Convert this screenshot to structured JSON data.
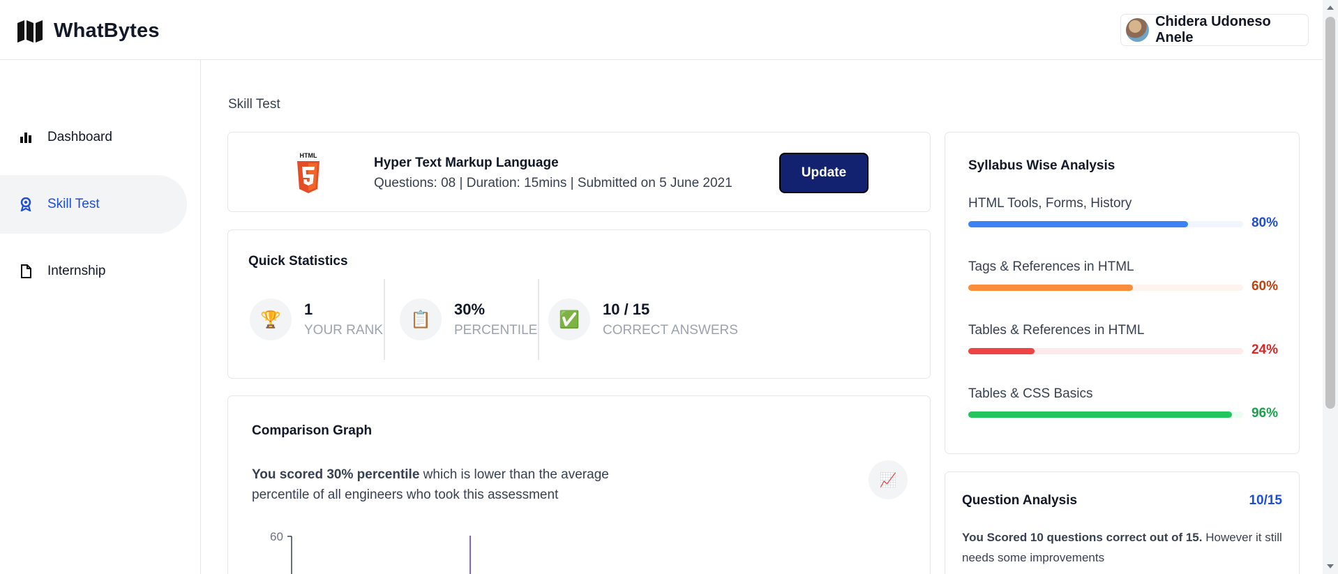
{
  "header": {
    "brand": "WhatBytes",
    "user_name": "Chidera Udoneso Anele"
  },
  "sidebar": {
    "items": [
      {
        "label": "Dashboard",
        "icon": "bar-chart-icon"
      },
      {
        "label": "Skill Test",
        "icon": "award-icon",
        "active": true
      },
      {
        "label": "Internship",
        "icon": "file-icon"
      }
    ]
  },
  "page": {
    "label": "Skill Test"
  },
  "test": {
    "badge_text": "HTML",
    "title": "Hyper Text Markup Language",
    "meta": "Questions: 08 | Duration: 15mins | Submitted on 5 June 2021",
    "update_label": "Update"
  },
  "stats": {
    "title": "Quick Statistics",
    "items": [
      {
        "value": "1",
        "label": "YOUR RANK",
        "icon": "trophy-icon"
      },
      {
        "value": "30%",
        "label": "PERCENTILE",
        "icon": "clipboard-icon"
      },
      {
        "value": "10 / 15",
        "label": "CORRECT ANSWERS",
        "icon": "check-box-icon"
      }
    ]
  },
  "graph": {
    "title": "Comparison Graph",
    "text_bold": "You scored 30% percentile",
    "text_rest": " which is lower than the average percentile of all engineers who took this assessment",
    "icon": "trend-chart-icon",
    "y_tick": "60"
  },
  "syllabus": {
    "title": "Syllabus Wise Analysis",
    "items": [
      {
        "label": "HTML Tools, Forms, History",
        "percent": 80,
        "percent_text": "80%",
        "color": "#3b82f6",
        "track": "#eff6ff",
        "text_color": "#1d4ed8"
      },
      {
        "label": "Tags & References in HTML",
        "percent": 60,
        "percent_text": "60%",
        "color": "#fb8c3c",
        "track": "#fff4ed",
        "text_color": "#c2410c"
      },
      {
        "label": "Tables & References in HTML",
        "percent": 24,
        "percent_text": "24%",
        "color": "#ef4444",
        "track": "#fdeaea",
        "text_color": "#dc2626"
      },
      {
        "label": "Tables & CSS Basics",
        "percent": 96,
        "percent_text": "96%",
        "color": "#22c55e",
        "track": "#ecfdf3",
        "text_color": "#16a34a"
      }
    ]
  },
  "question_analysis": {
    "title": "Question Analysis",
    "score": "10/15",
    "text_bold": "You Scored 10 questions correct out of 15.",
    "text_rest": " However it still needs some improvements"
  }
}
